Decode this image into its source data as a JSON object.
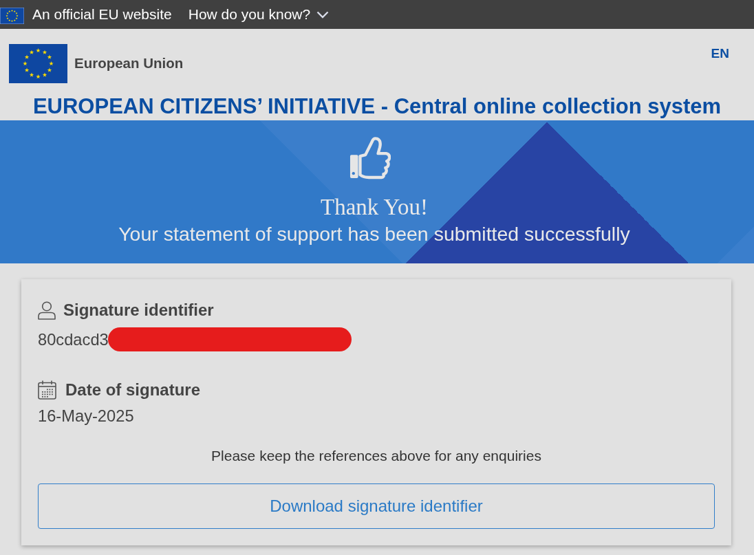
{
  "top_bar": {
    "label": "An official EU website",
    "link": "How do you know?",
    "expanded": false
  },
  "header": {
    "logo_text": "European Union",
    "language": "EN"
  },
  "site_title": "EUROPEAN CITIZENS’ INITIATIVE - Central online collection system",
  "banner": {
    "heading": "Thank You!",
    "message": "Your statement of support has been submitted successfully"
  },
  "details": [
    {
      "kind": "identifier",
      "label": "Signature identifier",
      "value": "80cdacd3",
      "redacted": true
    },
    {
      "kind": "date",
      "label": "Date of signature",
      "value": "16-May-2025",
      "redacted": false
    }
  ],
  "note": "Please keep the references above for any enquiries",
  "download_button": "Download signature identifier"
}
